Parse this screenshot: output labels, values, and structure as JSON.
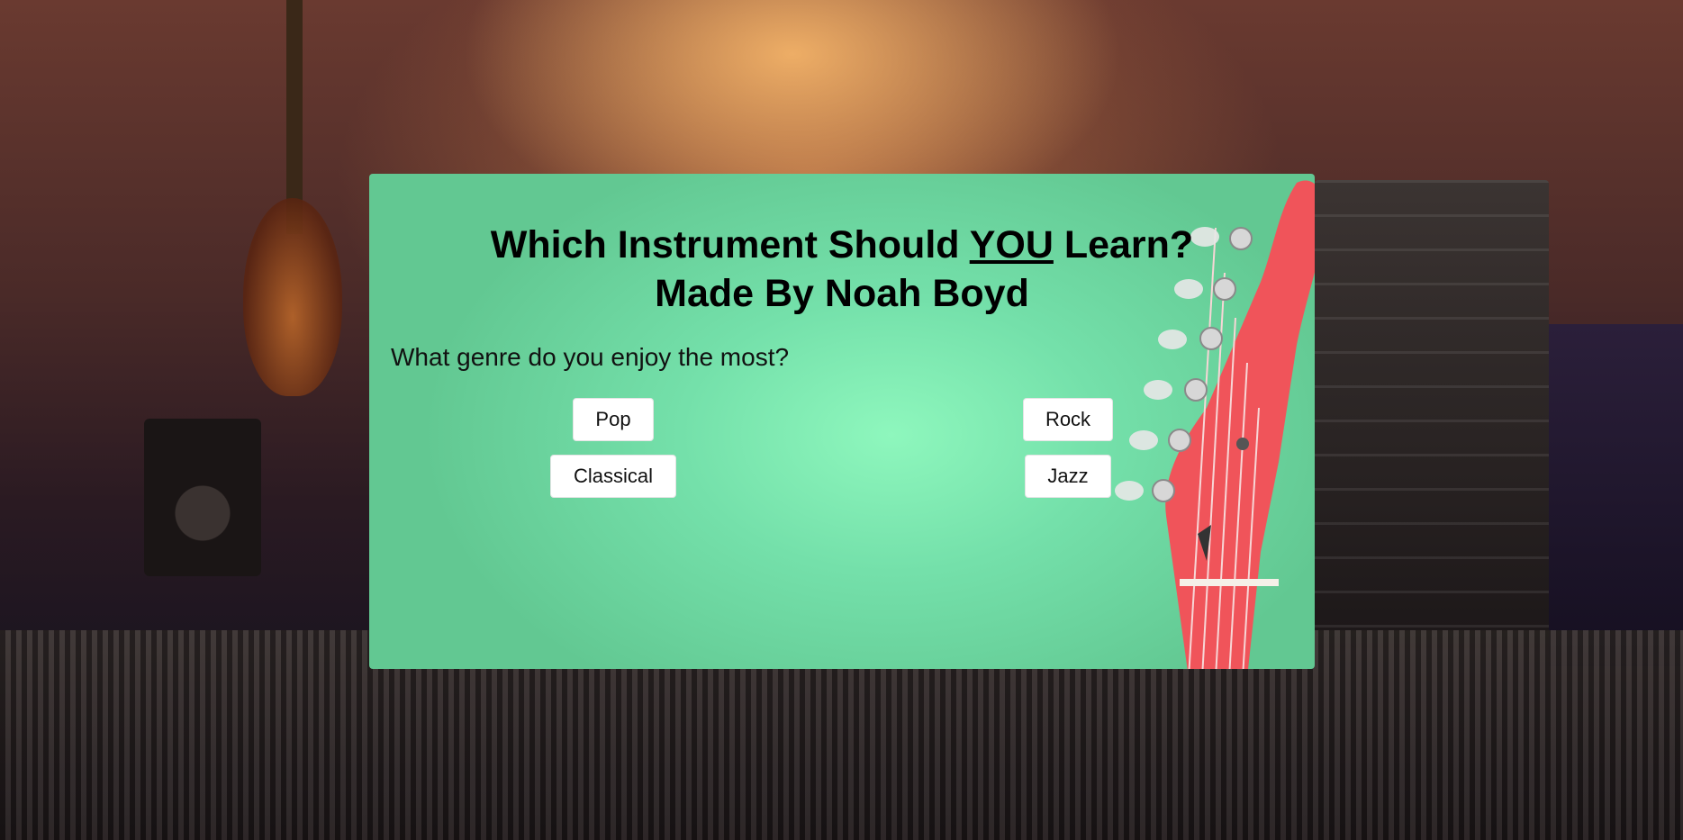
{
  "quiz": {
    "title_part1": "Which Instrument Should ",
    "title_emphasis": "YOU",
    "title_part2": " Learn?",
    "subtitle": "Made By Noah Boyd",
    "question": "What genre do you enjoy the most?",
    "options": [
      "Pop",
      "Rock",
      "Classical",
      "Jazz"
    ]
  },
  "colors": {
    "panel": "#74e0aa",
    "button": "#ffffff",
    "guitar_headstock": "#f0545a"
  }
}
